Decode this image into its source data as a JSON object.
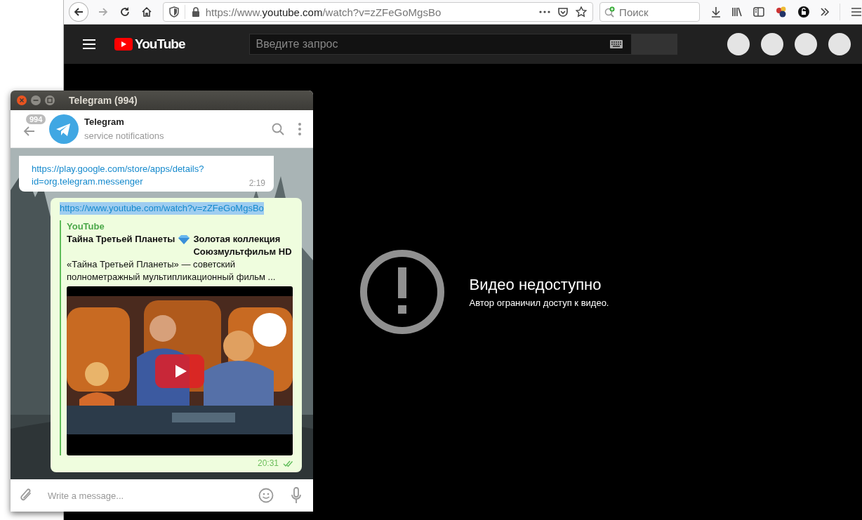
{
  "browser": {
    "forward": {
      "disabled": true
    },
    "address": {
      "prefix": "https://www.",
      "domain": "youtube.com",
      "path": "/watch?v=zZFeGoMgsBo"
    },
    "search": {
      "placeholder": "Поиск"
    }
  },
  "youtube": {
    "logo": "YouTube",
    "search": {
      "placeholder": "Введите запрос"
    },
    "notice": {
      "title": "Видео недоступно",
      "subtitle": "Автор ограничил доступ к видео."
    }
  },
  "telegram": {
    "window_title": "Telegram (994)",
    "unread_badge": "994",
    "chat": {
      "name": "Telegram",
      "status": "service notifications"
    },
    "messages": [
      {
        "kind": "incoming",
        "link": "https://play.google.com/store/apps/details?id=org.telegram.messenger",
        "time": "2:19"
      },
      {
        "kind": "outgoing",
        "link": "https://www.youtube.com/watch?v=zZFeGoMgsBo",
        "link_selected": true,
        "preview": {
          "site": "YouTube",
          "title_parts": [
            "Тайна Третьей Планеты",
            "Золотая коллекция Союзмультфильм HD"
          ],
          "description": "«Тайна Третьей Планеты» — советский полнометражный мультипликационный фильм ..."
        },
        "time": "20:31",
        "read": true
      }
    ],
    "composer": {
      "placeholder": "Write a message..."
    }
  }
}
